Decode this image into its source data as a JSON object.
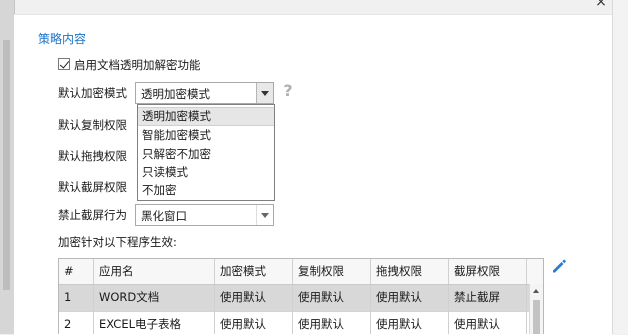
{
  "window": {
    "close_glyph": "×"
  },
  "section": {
    "title": "策略内容"
  },
  "enable_option": {
    "label": "启用文档透明加解密功能",
    "checked": true
  },
  "form": {
    "default_encrypt_mode": {
      "label": "默认加密模式",
      "value": "透明加密模式"
    },
    "default_copy_permission": {
      "label": "默认复制权限"
    },
    "default_drag_permission": {
      "label": "默认拖拽权限"
    },
    "default_screenshot_permission": {
      "label": "默认截屏权限"
    },
    "block_screenshot_behavior": {
      "label": "禁止截屏行为",
      "value": "黑化窗口"
    }
  },
  "help": {
    "glyph": "?"
  },
  "encrypt_mode_dropdown": {
    "options": [
      "透明加密模式",
      "智能加密模式",
      "只解密不加密",
      "只读模式",
      "不加密"
    ],
    "selected_index": 0
  },
  "program_scope": {
    "label": "加密针对以下程序生效:"
  },
  "program_table": {
    "headers": [
      "#",
      "应用名",
      "加密模式",
      "复制权限",
      "拖拽权限",
      "截屏权限"
    ],
    "rows": [
      [
        "1",
        "WORD文档",
        "使用默认",
        "使用默认",
        "使用默认",
        "禁止截屏"
      ],
      [
        "2",
        "EXCEL电子表格",
        "使用默认",
        "使用默认",
        "使用默认",
        "使用默认"
      ]
    ],
    "selected_row": 0
  },
  "colors": {
    "accent": "#1e74c4",
    "edit_icon": "#2b7cd3"
  },
  "icons": {
    "edit": "pencil-icon",
    "help": "question-icon",
    "close": "close-icon"
  }
}
